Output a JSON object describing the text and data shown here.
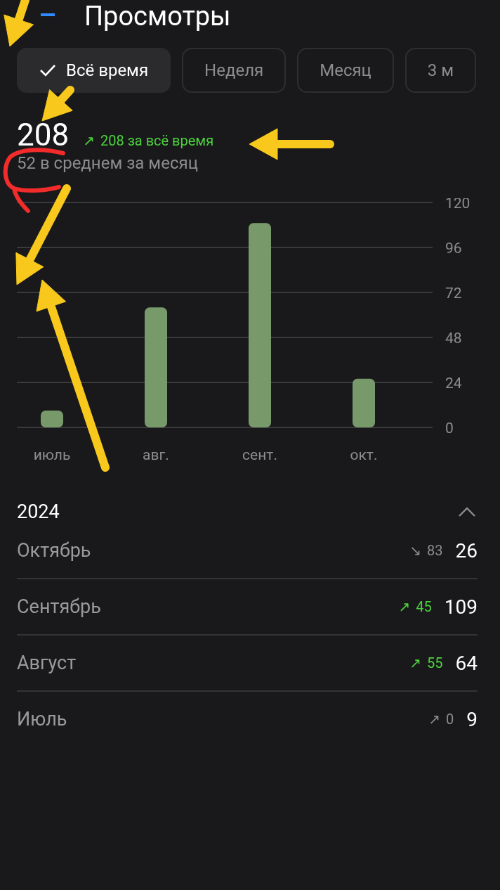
{
  "header": {
    "title": "Просмотры"
  },
  "periods": [
    {
      "label": "Всё время",
      "selected": true
    },
    {
      "label": "Неделя",
      "selected": false
    },
    {
      "label": "Месяц",
      "selected": false
    },
    {
      "label": "3 м",
      "selected": false
    }
  ],
  "summary": {
    "total": "208",
    "trend": "↗",
    "highlighted": true,
    "change": "208 за всё время",
    "average": "52 в среднем за месяц"
  },
  "chart_data": {
    "type": "bar",
    "categories": [
      "июль",
      "авг.",
      "сент.",
      "окт."
    ],
    "values": [
      9,
      64,
      109,
      26
    ],
    "ylim": [
      0,
      120
    ],
    "yticks": [
      0,
      24,
      48,
      72,
      96,
      120
    ],
    "grid": true
  },
  "year_group": {
    "year": "2024",
    "expanded": true,
    "months": [
      {
        "name": "Октябрь",
        "trend": "↘",
        "highlighted": false,
        "change": "83",
        "views": "26"
      },
      {
        "name": "Сентябрь",
        "trend": "↗",
        "highlighted": true,
        "change": "45",
        "views": "109"
      },
      {
        "name": "Август",
        "trend": "↗",
        "highlighted": true,
        "change": "55",
        "views": "64"
      },
      {
        "name": "Июль",
        "trend": "↗",
        "highlighted": false,
        "change": "0",
        "views": "9"
      }
    ]
  }
}
